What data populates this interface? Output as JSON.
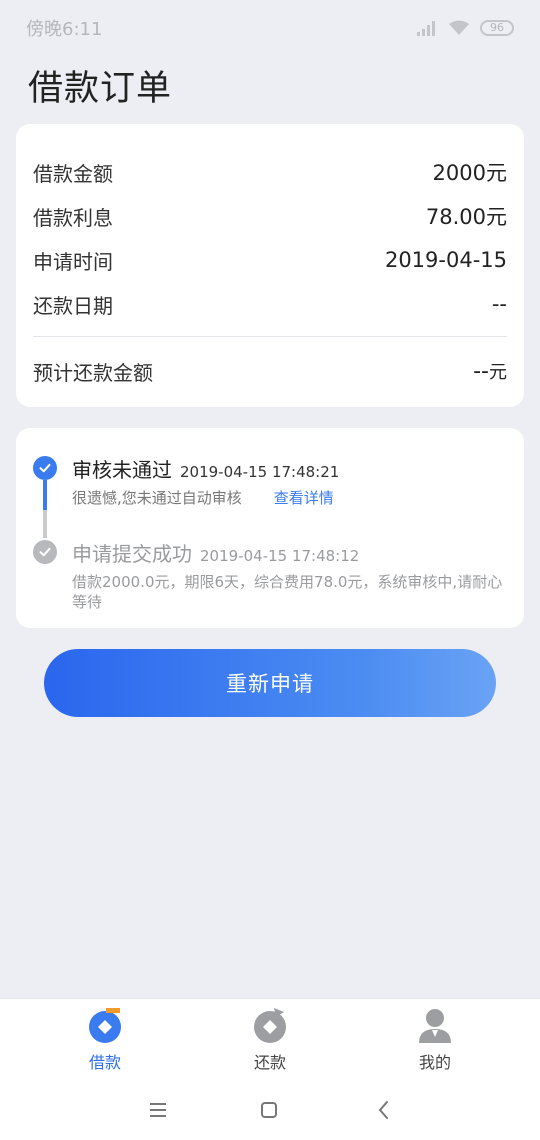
{
  "status_bar": {
    "time": "傍晚6:11",
    "battery": "96"
  },
  "page": {
    "title": "借款订单"
  },
  "summary": {
    "rows": [
      {
        "label": "借款金额",
        "value": "2000元"
      },
      {
        "label": "借款利息",
        "value": "78.00元"
      },
      {
        "label": "申请时间",
        "value": "2019-04-15"
      },
      {
        "label": "还款日期",
        "value": "--"
      }
    ],
    "total": {
      "label": "预计还款金额",
      "value": "--",
      "unit": "元"
    }
  },
  "timeline": [
    {
      "title": "审核未通过",
      "time": "2019-04-15 17:48:21",
      "desc": "很遗憾,您未通过自动审核",
      "link": "查看详情"
    },
    {
      "title": "申请提交成功",
      "time": "2019-04-15 17:48:12",
      "desc": "借款2000.0元，期限6天，综合费用78.0元，系统审核中,请耐心等待"
    }
  ],
  "action": {
    "reapply_label": "重新申请"
  },
  "tabs": [
    {
      "label": "借款",
      "icon": "borrow-icon"
    },
    {
      "label": "还款",
      "icon": "repay-icon"
    },
    {
      "label": "我的",
      "icon": "profile-icon"
    }
  ],
  "colors": {
    "accent": "#3a7bf0",
    "background": "#eceef3",
    "inactive": "#b8b9bc"
  }
}
